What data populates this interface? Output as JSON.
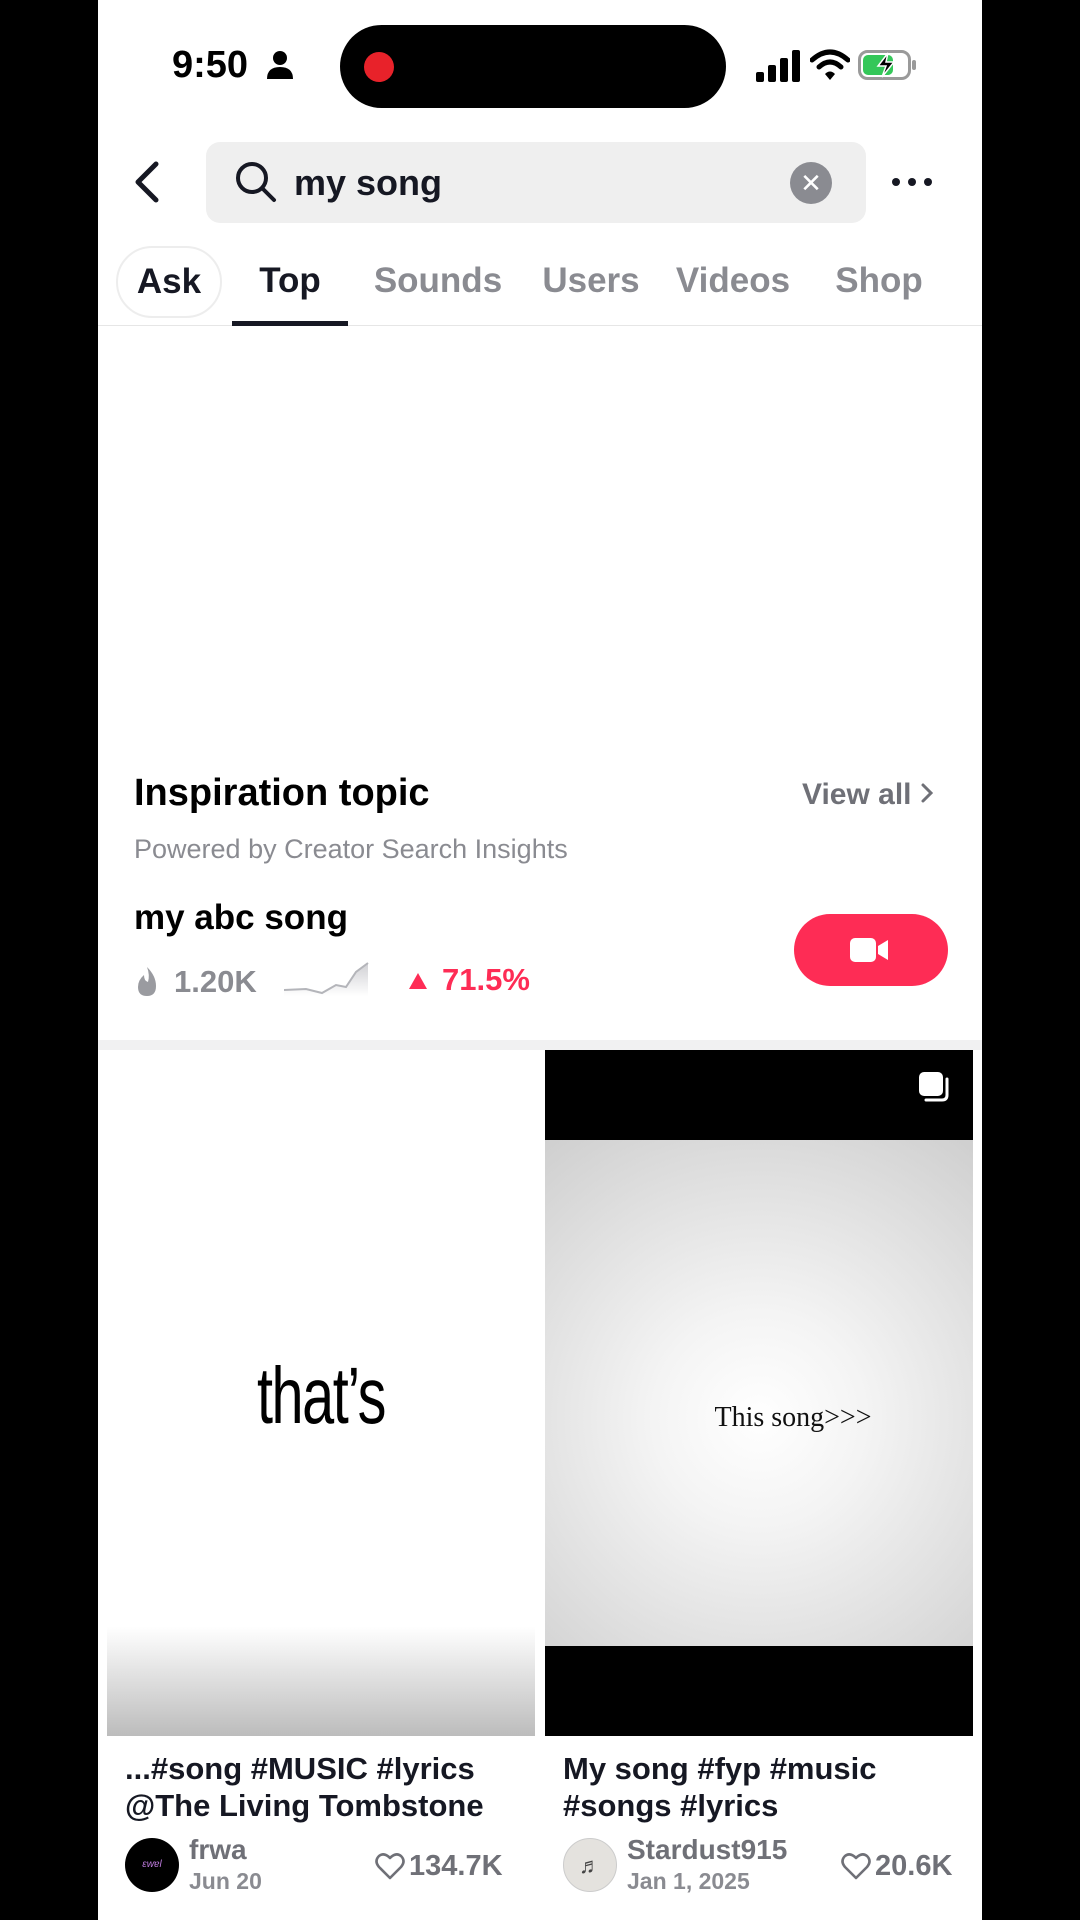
{
  "status_bar": {
    "time": "9:50"
  },
  "search": {
    "query": "my song",
    "clear_glyph": "✕"
  },
  "tabs": [
    {
      "label": "Ask"
    },
    {
      "label": "Top"
    },
    {
      "label": "Sounds"
    },
    {
      "label": "Users"
    },
    {
      "label": "Videos"
    },
    {
      "label": "Shop"
    }
  ],
  "active_tab": "Top",
  "inspiration": {
    "title": "Inspiration topic",
    "view_all": "View all",
    "powered_by": "Powered by Creator Search Insights",
    "topic": "my abc song",
    "views": "1.20K",
    "growth": "71.5%"
  },
  "videos": [
    {
      "thumbnail_text": "that’s",
      "caption": "...#song #MUSIC #lyrics @The Living Tombstone",
      "author": "frwa",
      "avatar_text": "ɛwɐl",
      "date": "Jun 20",
      "likes": "134.7K"
    },
    {
      "thumbnail_text": "This song>>>",
      "caption": "My song #fyp #music #songs #lyrics",
      "author": "Stardust915",
      "avatar_text": "♬",
      "date": "Jan 1, 2025",
      "likes": "20.6K"
    }
  ],
  "colors": {
    "accent": "#fe2c55",
    "text": "#161823",
    "muted": "#8a8b91"
  }
}
